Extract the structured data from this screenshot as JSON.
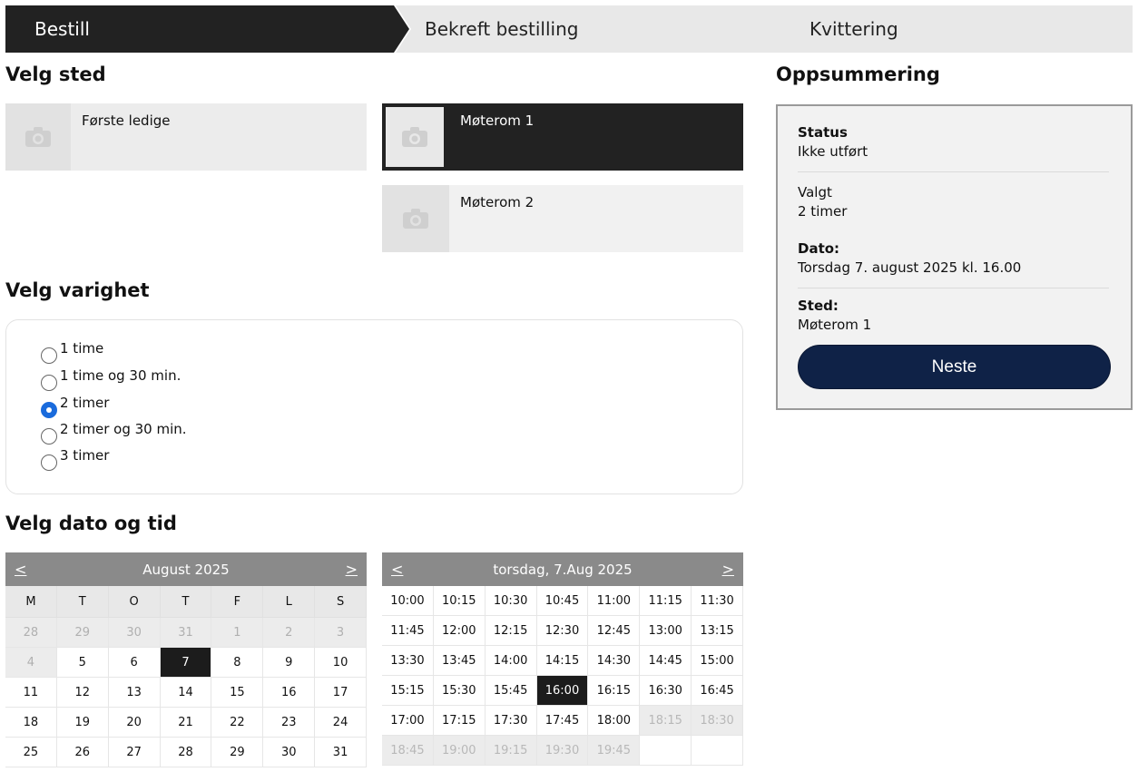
{
  "stepper": {
    "steps": [
      "Bestill",
      "Bekreft bestilling",
      "Kvittering"
    ]
  },
  "location": {
    "heading": "Velg sted",
    "options": [
      "Første ledige",
      "Møterom 1",
      "Møterom 2"
    ],
    "selected": "Møterom 1"
  },
  "duration": {
    "heading": "Velg varighet",
    "options": [
      "1 time",
      "1 time og 30 min.",
      "2 timer",
      "2 timer og 30 min.",
      "3 timer"
    ],
    "selected": "2 timer"
  },
  "datetime": {
    "heading": "Velg dato og tid",
    "calendar": {
      "prev": "<",
      "next": ">",
      "month_label": "August 2025",
      "weekdays": [
        "M",
        "T",
        "O",
        "T",
        "F",
        "L",
        "S"
      ],
      "days": [
        "28",
        "29",
        "30",
        "31",
        "1",
        "2",
        "3",
        "4",
        "5",
        "6",
        "7",
        "8",
        "9",
        "10",
        "11",
        "12",
        "13",
        "14",
        "15",
        "16",
        "17",
        "18",
        "19",
        "20",
        "21",
        "22",
        "23",
        "24",
        "25",
        "26",
        "27",
        "28",
        "29",
        "30",
        "31"
      ],
      "muted_indices": [
        0,
        1,
        2,
        3,
        4,
        5,
        6,
        7
      ],
      "selected_index": 10
    },
    "times": {
      "prev": "<",
      "next": ">",
      "day_label": "torsdag, 7.Aug 2025",
      "slots": [
        "10:00",
        "10:15",
        "10:30",
        "10:45",
        "11:00",
        "11:15",
        "11:30",
        "11:45",
        "12:00",
        "12:15",
        "12:30",
        "12:45",
        "13:00",
        "13:15",
        "13:30",
        "13:45",
        "14:00",
        "14:15",
        "14:30",
        "14:45",
        "15:00",
        "15:15",
        "15:30",
        "15:45",
        "16:00",
        "16:15",
        "16:30",
        "16:45",
        "17:00",
        "17:15",
        "17:30",
        "17:45",
        "18:00",
        "18:15",
        "18:30",
        "18:45",
        "19:00",
        "19:15",
        "19:30",
        "19:45"
      ],
      "unavailable_from_index": 33,
      "selected_index": 24
    }
  },
  "summary": {
    "heading": "Oppsummering",
    "status_label": "Status",
    "status_value": "Ikke utført",
    "chosen_label": "Valgt",
    "chosen_value": "2 timer",
    "date_label": "Dato:",
    "date_value": "Torsdag 7. august 2025 kl. 16.00",
    "place_label": "Sted:",
    "place_value": "Møterom 1",
    "next_button": "Neste"
  },
  "colors": {
    "dark": "#222222",
    "primary_button": "#0f2247",
    "radio_checked": "#1a6bdc",
    "calendar_header": "#8a8a8a"
  }
}
